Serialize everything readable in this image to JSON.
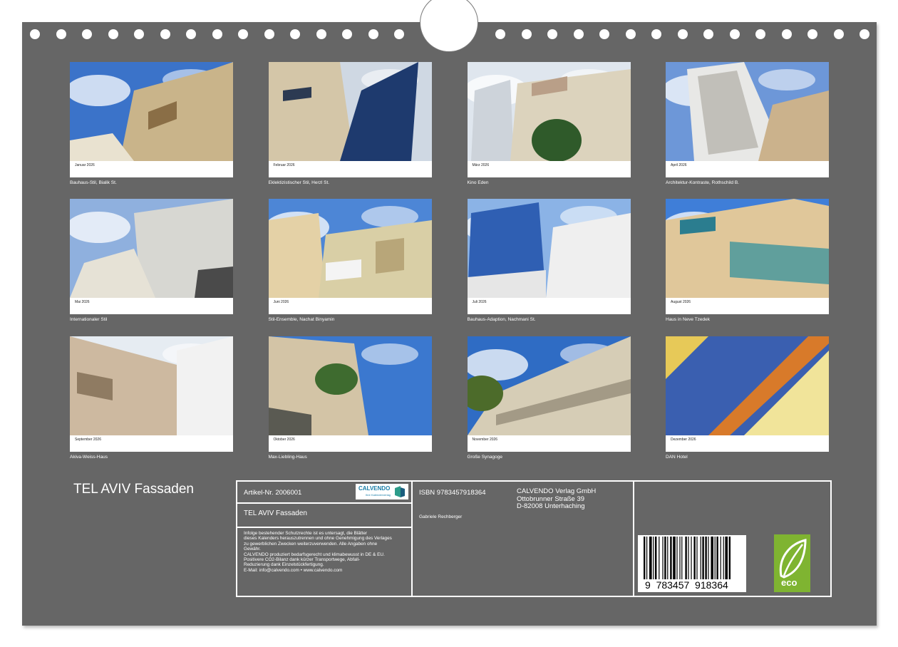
{
  "months": [
    {
      "name": "Januar 2026",
      "caption": "Bauhaus-Stil, Bialik St."
    },
    {
      "name": "Februar 2026",
      "caption": "Eklektizistischer Stil, Herzl St."
    },
    {
      "name": "März 2026",
      "caption": "Kino Eden"
    },
    {
      "name": "April 2026",
      "caption": "Architektur-Kontraste, Rothschild B."
    },
    {
      "name": "Mai 2026",
      "caption": "Internationaler Stil"
    },
    {
      "name": "Juni 2026",
      "caption": "Stil-Ensemble, Nachat Binyamin"
    },
    {
      "name": "Juli 2026",
      "caption": "Bauhaus-Adaption, Nachmani St."
    },
    {
      "name": "August 2026",
      "caption": "Haus in Neve Tzedek"
    },
    {
      "name": "September 2026",
      "caption": "Akiva-Weiss-Haus"
    },
    {
      "name": "Oktober 2026",
      "caption": "Max-Liebling-Haus"
    },
    {
      "name": "November 2026",
      "caption": "Große Synagoge"
    },
    {
      "name": "Dezember 2026",
      "caption": "DAN Hotel"
    }
  ],
  "title": "TEL AVIV Fassaden",
  "info": {
    "article": "Artikel-Nr. 2006001",
    "product_title": "TEL AVIV Fassaden",
    "legal_lines": [
      "Infolge bestehender Schutzrechte ist es untersagt, die Blätter",
      "dieses Kalenders herauszutrennen und ohne Genehmigung des Verlages",
      "zu gewerblichen Zwecken weiterzuverwenden. Alle Angaben ohne",
      "Gewähr.",
      "CALVENDO produziert bedarfsgerecht und klimabewusst in DE & EU.",
      "Positivere CO2-Bilanz dank kürzer Transportwege, Abfall-",
      "Reduzierung dank Einzelstückfertigung.",
      "E-Mail: info@calvendo.com • www.calvendo.com"
    ],
    "isbn": "ISBN 9783457918364",
    "author": "Gabriele Rechberger",
    "publisher_lines": [
      "CALVENDO Verlag GmbH",
      "Ottobrunner Straße 39",
      "D-82008 Unterhaching"
    ],
    "logo_brand": "CALVENDO",
    "logo_sub": "Ihre Kalenderverlag",
    "barcode_digits": "9  783457  918364",
    "eco_label": "eco"
  }
}
